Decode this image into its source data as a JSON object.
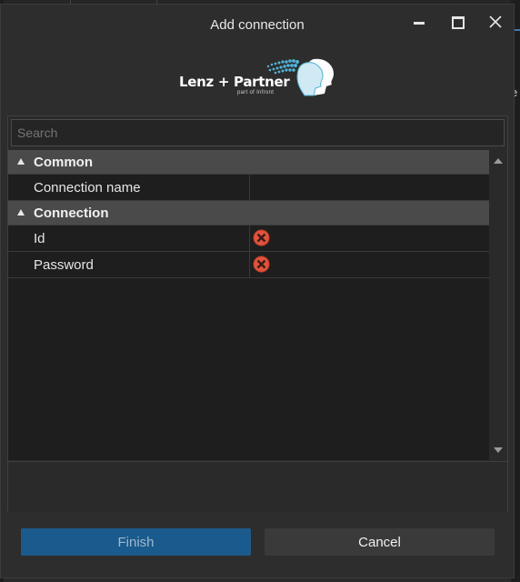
{
  "dialog": {
    "title": "Add connection"
  },
  "logo": {
    "name": "Lenz + Partner",
    "tagline": "part of Infront"
  },
  "search": {
    "placeholder": "Search"
  },
  "property_grid": {
    "categories": [
      {
        "label": "Common",
        "properties": [
          {
            "name": "Connection name",
            "value": "",
            "error": false
          }
        ]
      },
      {
        "label": "Connection",
        "properties": [
          {
            "name": "Id",
            "value": "",
            "error": true
          },
          {
            "name": "Password",
            "value": "",
            "error": true
          }
        ]
      }
    ]
  },
  "buttons": {
    "finish": "Finish",
    "cancel": "Cancel"
  },
  "background": {
    "edge_char": "e"
  },
  "colors": {
    "accent": "#1b5a8c",
    "error": "#e0533c"
  },
  "icons": [
    "minimize-icon",
    "maximize-icon",
    "close-icon",
    "collapse-triangle-icon",
    "error-icon",
    "scroll-up-icon",
    "scroll-down-icon"
  ]
}
